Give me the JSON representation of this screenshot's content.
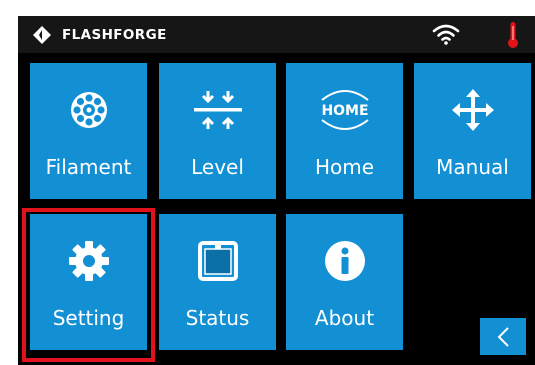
{
  "header": {
    "brand": "FLASHFORGE",
    "icons": [
      "flashforge-logo-icon",
      "wifi-icon",
      "thermometer-icon"
    ]
  },
  "menu": {
    "filament_label": "Filament",
    "level_label": "Level",
    "home_label": "Home",
    "home_icon_text": "HOME",
    "manual_label": "Manual",
    "setting_label": "Setting",
    "status_label": "Status",
    "about_label": "About"
  },
  "selected_item": "Setting",
  "colors": {
    "tile": "#138fd3",
    "background": "#000000",
    "highlight": "#e0121b",
    "thermometer": "#e0121b"
  }
}
